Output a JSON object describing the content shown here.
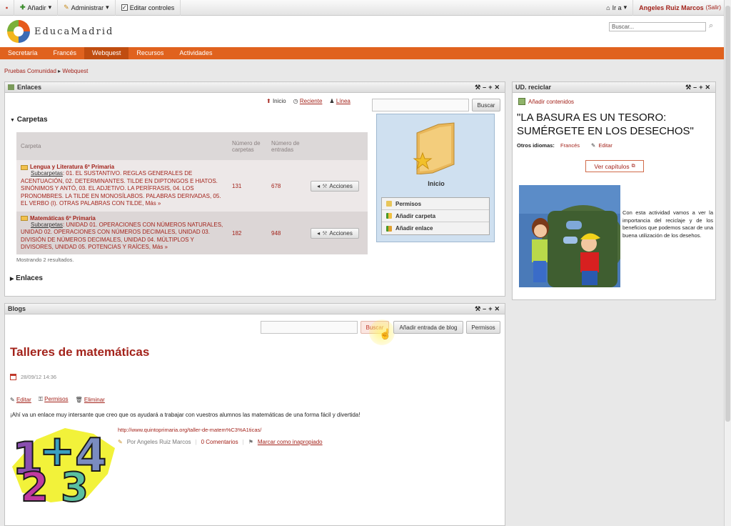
{
  "dock": {
    "add_label": "Añadir",
    "manage_label": "Administrar",
    "edit_controls_label": "Editar controles",
    "goto_label": "Ir a",
    "user_name": "Angeles Ruiz Marcos",
    "signout_label": "(Salir)"
  },
  "header": {
    "logo_text": "EducaMadrid",
    "search_placeholder": "Buscar..."
  },
  "nav": {
    "items": [
      "Secretaría",
      "Francés",
      "Webquest",
      "Recursos",
      "Actividades"
    ],
    "active": "Webquest"
  },
  "breadcrumb": [
    "Pruebas Comunidad",
    "Webquest"
  ],
  "enlaces": {
    "title": "Enlaces",
    "home_label": "Inicio",
    "recent_label": "Reciente",
    "line_label": "Línea",
    "search_button": "Buscar",
    "folders_heading": "Carpetas",
    "columns": [
      "Carpeta",
      "Número de carpetas",
      "Número de entradas"
    ],
    "rows": [
      {
        "name": "Lengua y Literatura 6º Primaria",
        "sub_label": "Subcarpetas",
        "subfolders": ": 01. EL SUSTANTIVO. REGLAS GENERALES DE ACENTUACIÓN, 02. DETERMINANTES. TILDE EN DIPTONGOS E HIATOS. SINÓNIMOS Y ANTÓ, 03. EL ADJETIVO. LA PERÍFRASIS, 04. LOS PRONOMBRES. LA TILDE EN MONOSÍLABOS. PALABRAS DERIVADAS, 05. EL VERBO (I). OTRAS PALABRAS CON TILDE,",
        "more": "Más »",
        "folders": "131",
        "entries": "678",
        "actions": "Acciones"
      },
      {
        "name": "Matemáticas 6º Primaria",
        "sub_label": "Subcarpetas",
        "subfolders": ": UNIDAD 01. OPERACIONES CON NÚMEROS NATURALES, UNIDAD 02. OPERACIONES CON NÚMEROS DECIMALES, UNIDAD 03. DIVISIÓN DE NÚMEROS DECIMALES, UNIDAD 04. MÚLTIPLOS Y DIVISORES, UNIDAD 05. POTENCIAS Y RAÍCES,",
        "more": "Más »",
        "folders": "182",
        "entries": "948",
        "actions": "Acciones"
      }
    ],
    "results": "Mostrando 2 resultados.",
    "links_heading": "Enlaces",
    "side_title": "Inicio",
    "side_menu": [
      "Permisos",
      "Añadir carpeta",
      "Añadir enlace"
    ]
  },
  "reciclar": {
    "title": "UD. reciclar",
    "add_content": "Añadir contenidos",
    "headline": "\"LA BASURA ES UN TESORO: SUMÉRGETE EN LOS DESECHOS\"",
    "other_lang_label": "Otros idiomas:",
    "other_lang_value": "Francés",
    "edit_label": "Editar",
    "chapters_button": "Ver capítulos",
    "description": "Con esta actividad vamos a ver la importancia del reciclaje y de los beneficios que podemos sacar de una buena utilización de los desehos."
  },
  "blogs": {
    "title": "Blogs",
    "search_button": "Buscar",
    "add_entry_button": "Añadir entrada de blog",
    "permissions_button": "Permisos",
    "post_title": "Talleres de matemáticas",
    "post_date": "28/09/12 14:36",
    "edit_label": "Editar",
    "perms_label": "Permisos",
    "delete_label": "Eliminar",
    "post_body": "¡Ahí va un enlace muy intersante que creo que os ayudará a trabajar con vuestros alumnos las matemáticas de una forma fácil y divertida!",
    "post_link": "http://www.quintoprimaria.org/taller-de-matem%C3%A1ticas/",
    "author": "Por Angeles Ruiz Marcos",
    "comments": "0 Comentarios",
    "flag": "Marcar como inapropiado",
    "numbers_art": "1234"
  }
}
